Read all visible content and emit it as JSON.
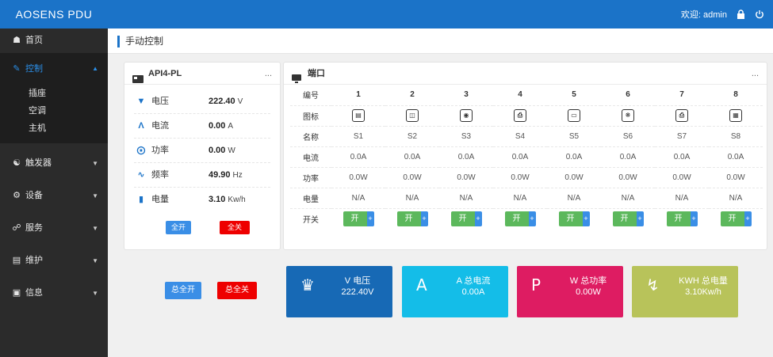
{
  "app": {
    "brand": "AOSENS PDU",
    "welcome": "欢迎: admin"
  },
  "sidebar": {
    "home": "首页",
    "control": "控制",
    "control_items": [
      "插座",
      "空调",
      "主机"
    ],
    "trigger": "触发器",
    "device": "设备",
    "service": "服务",
    "maintain": "维护",
    "info": "信息"
  },
  "page": {
    "title": "手动控制"
  },
  "device_panel": {
    "name": "API4-PL",
    "more": "...",
    "voltage": {
      "label": "电压",
      "value": "222.40",
      "unit": "V"
    },
    "current": {
      "label": "电流",
      "value": "0.00",
      "unit": "A"
    },
    "power": {
      "label": "功率",
      "value": "0.00",
      "unit": "W"
    },
    "frequency": {
      "label": "频率",
      "value": "49.90",
      "unit": "Hz"
    },
    "energy": {
      "label": "电量",
      "value": "3.10",
      "unit": "Kw/h"
    },
    "all_on": "全开",
    "all_off": "全关"
  },
  "port_panel": {
    "title": "端口",
    "more": "...",
    "row_labels": {
      "number": "编号",
      "icon": "图标",
      "name": "名称",
      "current": "电流",
      "power": "功率",
      "energy": "电量",
      "switch": "开关"
    },
    "switch_label": "开",
    "switch_plus": "+",
    "ports": [
      {
        "number": "1",
        "icon": "router-icon",
        "name": "S1",
        "current": "0.0A",
        "power": "0.0W",
        "energy": "N/A"
      },
      {
        "number": "2",
        "icon": "switch-icon",
        "name": "S2",
        "current": "0.0A",
        "power": "0.0W",
        "energy": "N/A"
      },
      {
        "number": "3",
        "icon": "camera-icon",
        "name": "S3",
        "current": "0.0A",
        "power": "0.0W",
        "energy": "N/A"
      },
      {
        "number": "4",
        "icon": "printer-icon",
        "name": "S4",
        "current": "0.0A",
        "power": "0.0W",
        "energy": "N/A"
      },
      {
        "number": "5",
        "icon": "monitor-icon",
        "name": "S5",
        "current": "0.0A",
        "power": "0.0W",
        "energy": "N/A"
      },
      {
        "number": "6",
        "icon": "fan-icon",
        "name": "S6",
        "current": "0.0A",
        "power": "0.0W",
        "energy": "N/A"
      },
      {
        "number": "7",
        "icon": "printer-icon",
        "name": "S7",
        "current": "0.0A",
        "power": "0.0W",
        "energy": "N/A"
      },
      {
        "number": "8",
        "icon": "panel-icon",
        "name": "S8",
        "current": "0.0A",
        "power": "0.0W",
        "energy": "N/A"
      }
    ]
  },
  "bottom": {
    "all_on": "总全开",
    "all_off": "总全关"
  },
  "tiles": [
    {
      "label": "V 电压",
      "value": "222.40V",
      "symbol": "voltage-icon",
      "color": "#1769b5"
    },
    {
      "label": "A 总电流",
      "value": "0.00A",
      "symbol": "A",
      "color": "#14bde8"
    },
    {
      "label": "W 总功率",
      "value": "0.00W",
      "symbol": "P",
      "color": "#de1c62"
    },
    {
      "label": "KWH 总电量",
      "value": "3.10Kw/h",
      "symbol": "bolt-icon",
      "color": "#b8c35a"
    }
  ]
}
